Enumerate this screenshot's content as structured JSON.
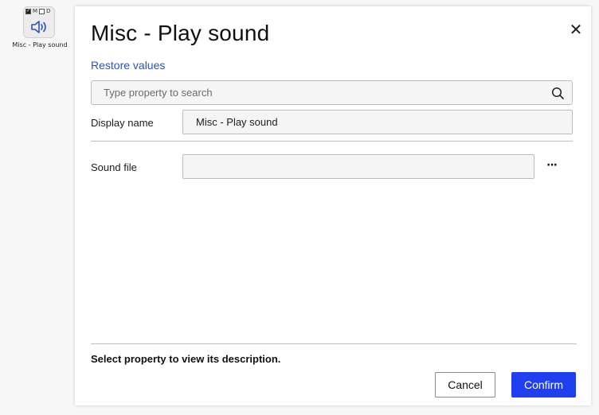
{
  "block": {
    "flag_m": "M",
    "flag_d": "D",
    "flag_m_checked": true,
    "flag_d_checked": false,
    "icon": "speaker-icon",
    "label": "Misc - Play sound"
  },
  "dialog": {
    "title": "Misc - Play sound",
    "close_icon": "close-icon",
    "restore_label": "Restore values",
    "search": {
      "placeholder": "Type property to search",
      "value": "",
      "icon": "search-icon"
    },
    "properties": [
      {
        "label": "Display name",
        "value": "Misc - Play sound"
      },
      {
        "label": "Sound file",
        "value": "",
        "browse_label": "···"
      }
    ],
    "description": "Select property to view its description.",
    "buttons": {
      "cancel": "Cancel",
      "confirm": "Confirm"
    },
    "colors": {
      "accent": "#1f3ff0",
      "link": "#2d52b8"
    }
  }
}
